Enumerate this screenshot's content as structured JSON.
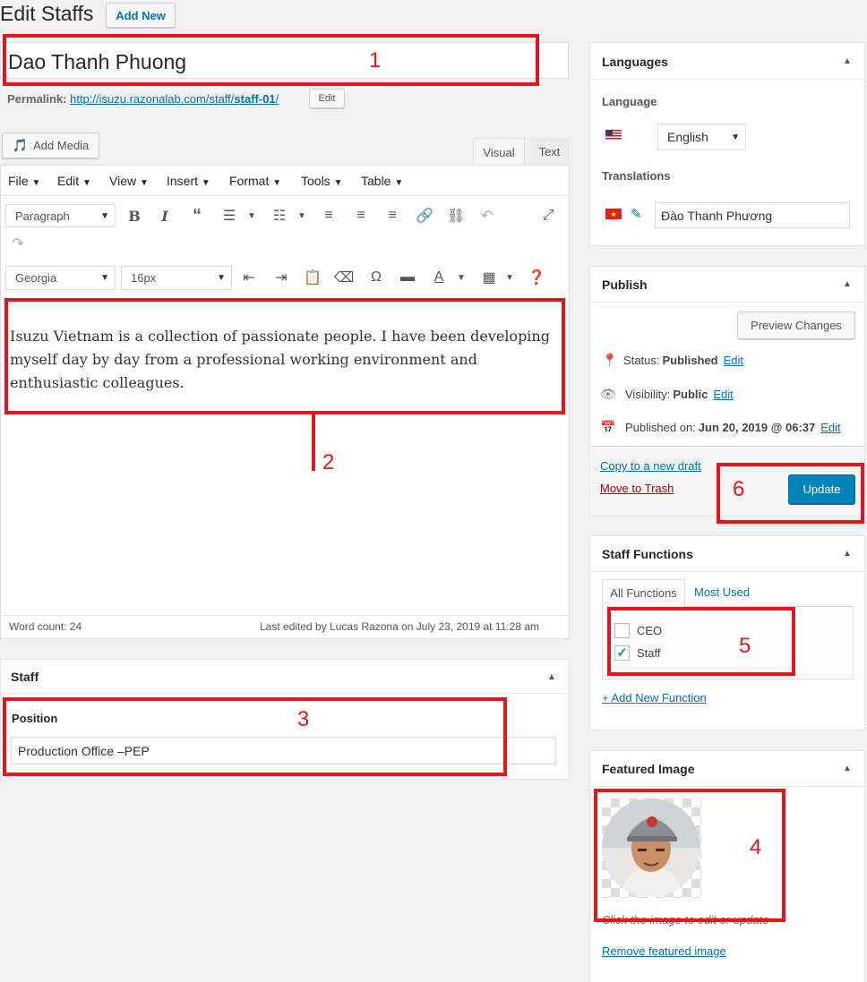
{
  "header": {
    "title": "Edit Staffs",
    "add_new": "Add New"
  },
  "post": {
    "title": "Dao Thanh Phuong",
    "permalink_label": "Permalink:",
    "permalink_base": "http://isuzu.razonalab.com/staff/",
    "permalink_slug": "staff-01",
    "permalink_end": "/",
    "permalink_edit": "Edit"
  },
  "editor": {
    "add_media": "Add Media",
    "tab_visual": "Visual",
    "tab_text": "Text",
    "menus": [
      "File",
      "Edit",
      "View",
      "Insert",
      "Format",
      "Tools",
      "Table"
    ],
    "format_select": "Paragraph",
    "font_select": "Georgia",
    "size_select": "16px",
    "content": "Isuzu Vietnam is a collection of passionate people. I have been developing myself day by day from a professional working environment and enthusiastic colleagues.",
    "word_count": "Word count: 24",
    "last_edited": "Last edited by Lucas Razona on July 23, 2019 at 11:28 am"
  },
  "staff_box": {
    "title": "Staff",
    "position_label": "Position",
    "position_value": "Production Office –PEP"
  },
  "languages_box": {
    "title": "Languages",
    "language_label": "Language",
    "language_value": "English",
    "translations_label": "Translations",
    "translation_value": "Đào Thanh Phương"
  },
  "publish_box": {
    "title": "Publish",
    "preview": "Preview Changes",
    "status_label": "Status:",
    "status_value": "Published",
    "visibility_label": "Visibility:",
    "visibility_value": "Public",
    "published_label": "Published on:",
    "published_value": "Jun 20, 2019 @ 06:37",
    "edit": "Edit",
    "copy_draft": "Copy to a new draft",
    "trash": "Move to Trash",
    "update": "Update"
  },
  "functions_box": {
    "title": "Staff Functions",
    "tab_all": "All Functions",
    "tab_most": "Most Used",
    "items": [
      {
        "label": "CEO",
        "checked": false
      },
      {
        "label": "Staff",
        "checked": true
      }
    ],
    "add_new": "+ Add New Function"
  },
  "featured_box": {
    "title": "Featured Image",
    "hint": "Click the image to edit or update",
    "remove": "Remove featured image"
  },
  "annotations": [
    "1",
    "2",
    "3",
    "4",
    "5",
    "6"
  ],
  "colors": {
    "primary": "#0085ba",
    "link": "#0073aa",
    "trash": "#a00",
    "annotation": "#e3161b"
  }
}
